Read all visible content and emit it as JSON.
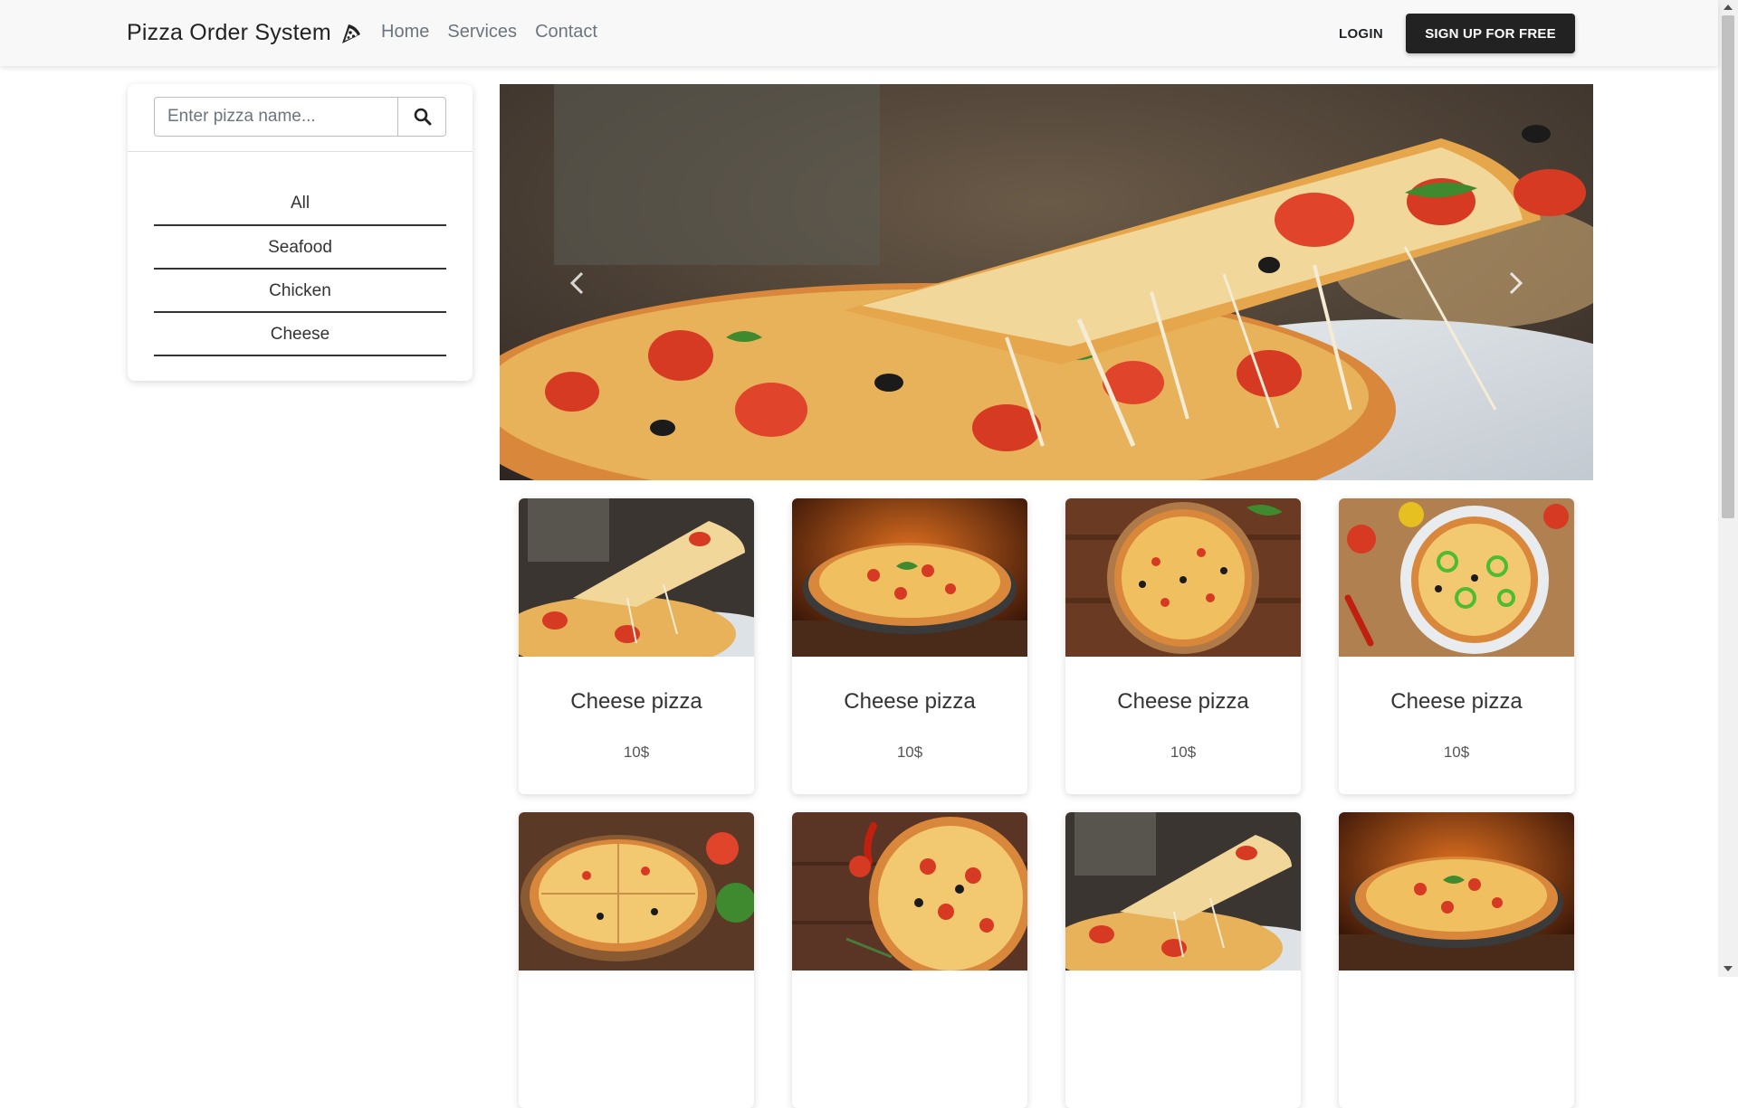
{
  "navbar": {
    "brand": "Pizza Order System",
    "brand_icon": "pizza-slice-icon",
    "links": [
      {
        "label": "Home"
      },
      {
        "label": "Services"
      },
      {
        "label": "Contact"
      }
    ],
    "login_label": "LOGIN",
    "signup_label": "SIGN UP FOR FREE"
  },
  "sidebar": {
    "search": {
      "placeholder": "Enter pizza name...",
      "value": "",
      "icon": "search-icon"
    },
    "categories": [
      {
        "label": "All"
      },
      {
        "label": "Seafood"
      },
      {
        "label": "Chicken"
      },
      {
        "label": "Cheese"
      }
    ]
  },
  "carousel": {
    "prev_icon": "chevron-left-icon",
    "next_icon": "chevron-right-icon"
  },
  "products": [
    {
      "name": "Cheese pizza",
      "price": "10$"
    },
    {
      "name": "Cheese pizza",
      "price": "10$"
    },
    {
      "name": "Cheese pizza",
      "price": "10$"
    },
    {
      "name": "Cheese pizza",
      "price": "10$"
    },
    {
      "name": "",
      "price": ""
    },
    {
      "name": "",
      "price": ""
    },
    {
      "name": "",
      "price": ""
    },
    {
      "name": "",
      "price": ""
    }
  ],
  "colors": {
    "navbar_bg": "#f8f8f8",
    "signup_bg": "#222222",
    "text_primary": "#212529",
    "text_muted": "#6c757d"
  }
}
